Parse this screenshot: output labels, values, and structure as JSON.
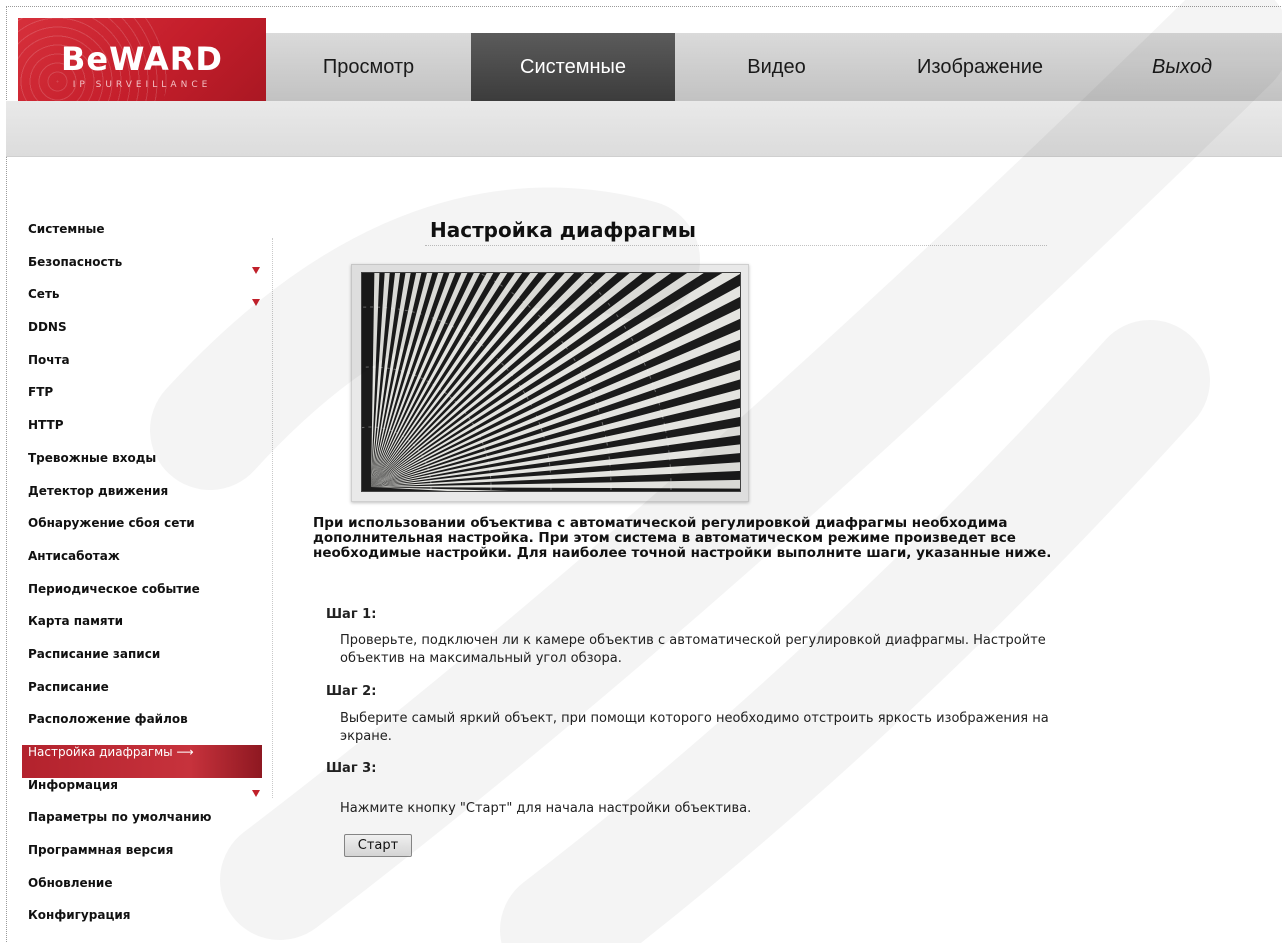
{
  "brand": {
    "name": "BeWARD",
    "tagline": "IP SURVEILLANCE"
  },
  "nav": {
    "items": [
      {
        "label": "Просмотр",
        "active": false
      },
      {
        "label": "Системные",
        "active": true
      },
      {
        "label": "Видео",
        "active": false
      },
      {
        "label": "Изображение",
        "active": false
      },
      {
        "label": "Выход",
        "active": false
      }
    ]
  },
  "sidebar": {
    "items": [
      {
        "label": "Системные",
        "has_submenu": false,
        "active": false
      },
      {
        "label": "Безопасность",
        "has_submenu": true,
        "active": false
      },
      {
        "label": "Сеть",
        "has_submenu": true,
        "active": false
      },
      {
        "label": "DDNS",
        "has_submenu": false,
        "active": false
      },
      {
        "label": "Почта",
        "has_submenu": false,
        "active": false
      },
      {
        "label": "FTP",
        "has_submenu": false,
        "active": false
      },
      {
        "label": "HTTP",
        "has_submenu": false,
        "active": false
      },
      {
        "label": "Тревожные входы",
        "has_submenu": false,
        "active": false
      },
      {
        "label": "Детектор движения",
        "has_submenu": false,
        "active": false
      },
      {
        "label": "Обнаружение сбоя сети",
        "has_submenu": false,
        "active": false
      },
      {
        "label": "Антисаботаж",
        "has_submenu": false,
        "active": false
      },
      {
        "label": "Периодическое событие",
        "has_submenu": false,
        "active": false
      },
      {
        "label": "Карта памяти",
        "has_submenu": false,
        "active": false
      },
      {
        "label": "Расписание записи",
        "has_submenu": false,
        "active": false
      },
      {
        "label": "Расписание",
        "has_submenu": false,
        "active": false
      },
      {
        "label": "Расположение файлов",
        "has_submenu": false,
        "active": false
      },
      {
        "label": "Настройка диафрагмы",
        "has_submenu": false,
        "active": true
      },
      {
        "label": "Информация",
        "has_submenu": true,
        "active": false
      },
      {
        "label": "Параметры по умолчанию",
        "has_submenu": false,
        "active": false
      },
      {
        "label": "Программная версия",
        "has_submenu": false,
        "active": false
      },
      {
        "label": "Обновление",
        "has_submenu": false,
        "active": false
      },
      {
        "label": "Конфигурация",
        "has_submenu": false,
        "active": false
      }
    ],
    "active_arrow": "⟶"
  },
  "main": {
    "title": "Настройка диафрагмы",
    "intro": "При использовании объектива с автоматической регулировкой диафрагмы необходима дополнительная настройка. При этом система в автоматическом режиме произведет все необходимые настройки. Для наиболее точной настройки выполните шаги, указанные ниже.",
    "steps": [
      {
        "label": "Шаг 1:",
        "text": "Проверьте, подключен ли к камере объектив с автоматической регулировкой диафрагмы. Настройте объектив на максимальный угол обзора."
      },
      {
        "label": "Шаг 2:",
        "text": "Выберите самый яркий объект, при помощи которого необходимо отстроить яркость изображения на экране."
      },
      {
        "label": "Шаг 3:",
        "text": "Нажмите кнопку \"Старт\" для начала настройки объектива."
      }
    ],
    "start_label": "Старт"
  },
  "colors": {
    "accent": "#c41e2b",
    "nav_active": "#4a4a4a",
    "nav_bg": "#cfcfcf"
  }
}
